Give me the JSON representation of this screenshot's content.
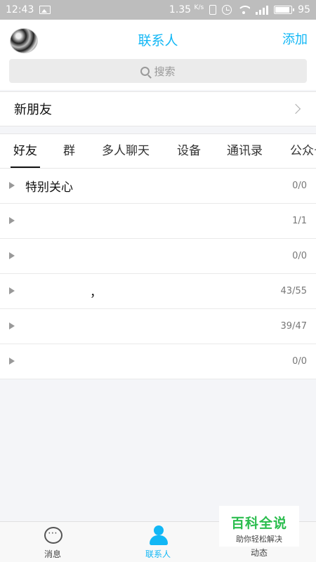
{
  "status_bar": {
    "time": "12:43",
    "speed_value": "1.35",
    "speed_unit": "K/s",
    "battery": "95"
  },
  "header": {
    "title": "联系人",
    "add_label": "添加"
  },
  "search": {
    "placeholder": "搜索"
  },
  "new_friends": {
    "label": "新朋友"
  },
  "tabs": [
    {
      "label": "好友",
      "active": true
    },
    {
      "label": "群",
      "active": false
    },
    {
      "label": "多人聊天",
      "active": false
    },
    {
      "label": "设备",
      "active": false
    },
    {
      "label": "通讯录",
      "active": false
    },
    {
      "label": "公众号",
      "active": false
    }
  ],
  "groups": [
    {
      "name": "特别关心",
      "count": "0/0"
    },
    {
      "name": "",
      "count": "1/1"
    },
    {
      "name": "",
      "count": "0/0"
    },
    {
      "name": "，",
      "count": "43/55"
    },
    {
      "name": "",
      "count": "39/47"
    },
    {
      "name": "",
      "count": "0/0"
    }
  ],
  "bottom_nav": {
    "messages_label": "消息",
    "contacts_label": "联系人",
    "feed_label": "动态"
  },
  "watermark": {
    "title": "百科全说",
    "subtitle": "助你轻松解决"
  },
  "colors": {
    "accent": "#12b7f5",
    "watermark_green": "#2bbd4e"
  }
}
